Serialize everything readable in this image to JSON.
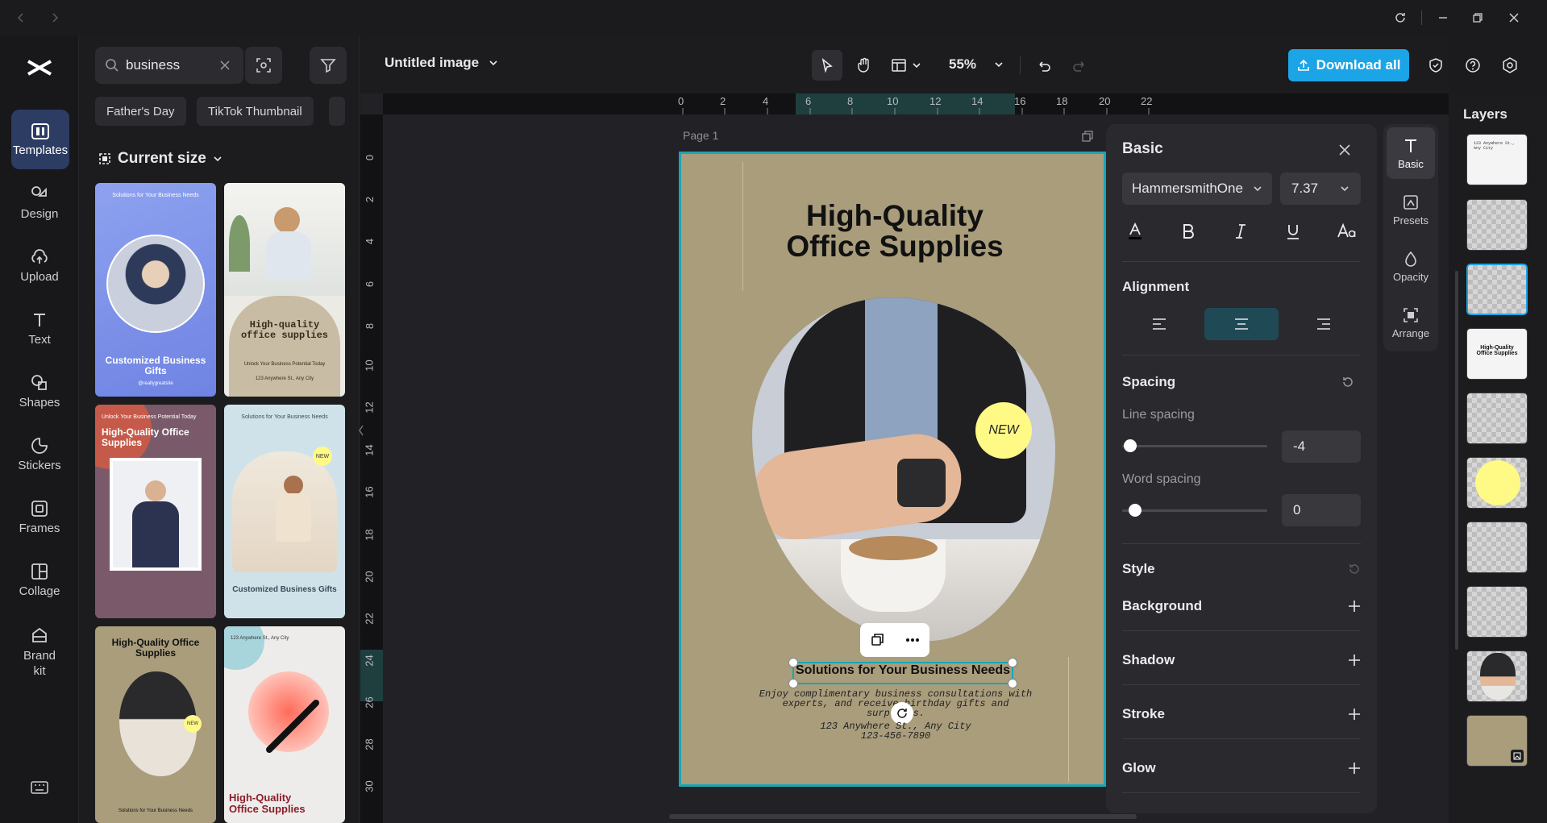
{
  "sidebar": {
    "items": [
      {
        "label": "Templates",
        "icon": "templates-icon"
      },
      {
        "label": "Design",
        "icon": "design-icon"
      },
      {
        "label": "Upload",
        "icon": "upload-icon"
      },
      {
        "label": "Text",
        "icon": "text-icon"
      },
      {
        "label": "Shapes",
        "icon": "shapes-icon"
      },
      {
        "label": "Stickers",
        "icon": "stickers-icon"
      },
      {
        "label": "Frames",
        "icon": "frames-icon"
      },
      {
        "label": "Collage",
        "icon": "collage-icon"
      },
      {
        "label": "Brand kit",
        "icon": "brand-kit-icon"
      }
    ]
  },
  "search": {
    "value": "business"
  },
  "chips": [
    "Father's Day",
    "TikTok Thumbnail"
  ],
  "size_filter": "Current size",
  "templates": [
    {
      "t1": "Solutions for Your Business Needs",
      "t2": "Customized Business Gifts",
      "t3": "@reallygreatsite"
    },
    {
      "t1": "High-quality office supplies",
      "t2": "Unlock Your Business Potential Today",
      "t3": "123 Anywhere St., Any City"
    },
    {
      "t1": "Unlock Your Business Potential Today",
      "t2": "High-Quality Office Supplies"
    },
    {
      "t1": "Solutions for Your Business Needs",
      "t2": "Customized Business Gifts",
      "badge": "NEW"
    },
    {
      "t1": "High-Quality Office Supplies",
      "t2": "Solutions for Your Business Needs",
      "badge": "NEW"
    },
    {
      "t1": "123 Anywhere St., Any City",
      "t2": "High-Quality Office Supplies"
    }
  ],
  "doc": {
    "title": "Untitled image",
    "zoom": "55%",
    "download": "Download all"
  },
  "ruler": {
    "top": [
      "0",
      "2",
      "4",
      "6",
      "8",
      "10",
      "12",
      "14",
      "16",
      "18",
      "20",
      "22"
    ],
    "left": [
      "0",
      "2",
      "4",
      "6",
      "8",
      "10",
      "12",
      "14",
      "16",
      "18",
      "20",
      "22",
      "24",
      "26",
      "28",
      "30"
    ]
  },
  "page": {
    "label": "Page 1",
    "heading": "High-Quality Office Supplies",
    "badge": "NEW",
    "subheading": "Solutions for Your Business Needs",
    "body": "Enjoy complimentary business consultations with experts, and receive birthday gifts and surprises.",
    "address": "123 Anywhere St., Any City",
    "phone": "123-456-7890"
  },
  "props": {
    "title": "Basic",
    "font": "HammersmithOne",
    "font_size": "7.37",
    "alignment": "Alignment",
    "spacing": "Spacing",
    "line_spacing_label": "Line spacing",
    "line_spacing": "-4",
    "word_spacing_label": "Word spacing",
    "word_spacing": "0",
    "style": "Style",
    "background": "Background",
    "shadow": "Shadow",
    "stroke": "Stroke",
    "glow": "Glow"
  },
  "tabs": [
    "Basic",
    "Presets",
    "Opacity",
    "Arrange"
  ],
  "layers": {
    "title": "Layers",
    "items": [
      "text-layer",
      "image-layer",
      "image-layer-selected",
      "heading-layer",
      "image-layer",
      "circle-layer",
      "image-layer",
      "image-layer",
      "photo-layer",
      "background-layer"
    ]
  },
  "colors": {
    "accent": "#1ba4e6",
    "selection": "#27b7c8",
    "page_bg": "#a99d7c",
    "new_badge": "#fff986"
  }
}
